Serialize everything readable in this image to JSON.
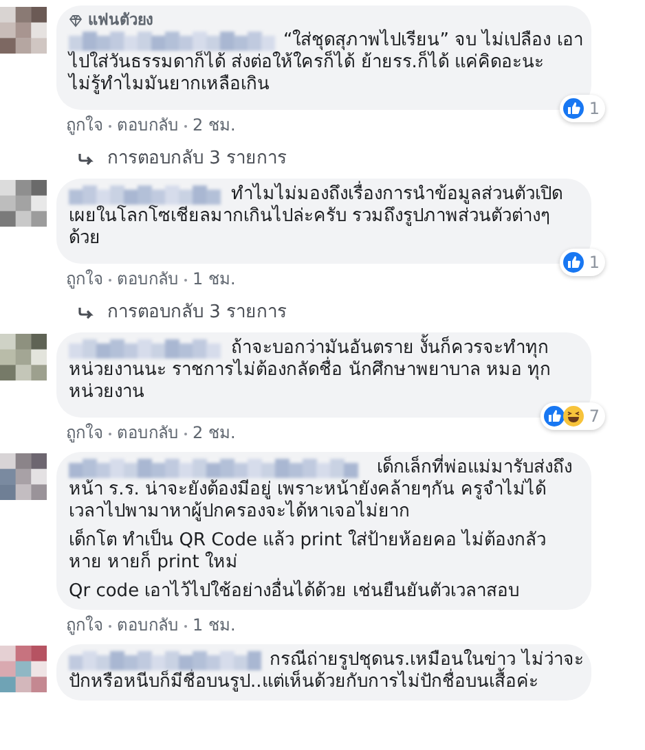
{
  "comments": [
    {
      "badge": "แฟนตัวยง",
      "paragraphs": [
        {
          "lines": [
            "“ใส่ชุดสุภาพไปเรียน” จบ ไม่เปลือง เอา",
            "ไปใส่วันธรรมดาก็ได้ ส่งต่อให้ใครก็ได้ ย้ายรร.ก็ได้ แค่คิดอะนะ",
            "ไม่รู้ทำไมมันยากเหลือเกิน"
          ]
        }
      ],
      "reactions": {
        "icons": [
          {
            "kind": "like"
          }
        ],
        "count": "1"
      },
      "actions": [
        "ถูกใจ",
        "ตอบกลับ",
        "2 ชม."
      ],
      "replies": "การตอบกลับ 3 รายการ"
    },
    {
      "paragraphs": [
        {
          "lines": [
            "ทำไมไม่มองถึงเรื่องการนำข้อมูลส่วนตัวเปิด",
            "เผยในโลกโซเชียลมากเกินไปล่ะครับ รวมถึงรูปภาพส่วนตัวต่างๆ",
            "ด้วย"
          ]
        }
      ],
      "reactions": {
        "icons": [
          {
            "kind": "like"
          }
        ],
        "count": "1"
      },
      "actions": [
        "ถูกใจ",
        "ตอบกลับ",
        "1 ชม."
      ],
      "replies": "การตอบกลับ 3 รายการ"
    },
    {
      "paragraphs": [
        {
          "lines": [
            "ถ้าจะบอกว่ามันอันตราย งั้นก็ควรจะทำทุก",
            "หน่วยงานนะ ราชการไม่ต้องกลัดชื่อ นักศึกษาพยาบาล หมอ ทุก",
            "หน่วยงาน"
          ]
        }
      ],
      "reactions": {
        "icons": [
          {
            "kind": "like"
          },
          {
            "kind": "haha"
          }
        ],
        "count": "7"
      },
      "actions": [
        "ถูกใจ",
        "ตอบกลับ",
        "2 ชม."
      ]
    },
    {
      "paragraphs": [
        {
          "lines": [
            "เด็กเล็กที่พ่อแม่มารับส่งถึง",
            "หน้า ร.ร. น่าจะยังต้องมีอยู่ เพราะหน้ายังคล้ายๆกัน ครูจำไม่ได้",
            "เวลาไปพามาหาผู้ปกครองจะได้หาเจอไม่ยาก"
          ]
        },
        {
          "lines": [
            "เด็กโต ทำเป็น QR Code แล้ว print ใส่ป้ายห้อยคอ ไม่ต้องกลัว",
            "หาย หายก็ print ใหม่"
          ]
        },
        {
          "lines": [
            "Qr code เอาไว้ไปใช้อย่างอื่นได้ด้วย เช่นยืนยันตัวเวลาสอบ"
          ]
        }
      ],
      "actions": [
        "ถูกใจ",
        "ตอบกลับ",
        "1 ชม."
      ]
    },
    {
      "paragraphs": [
        {
          "lines": [
            "กรณีถ่ายรูปชุดนร.เหมือนในข่าว ไม่ว่าจะ",
            "ปักหรือหนีบก็มีชื่อบนรูป..แต่เห็นด้วยกับการไม่ปักชื่อบนเสื้อค่ะ"
          ]
        }
      ]
    }
  ]
}
